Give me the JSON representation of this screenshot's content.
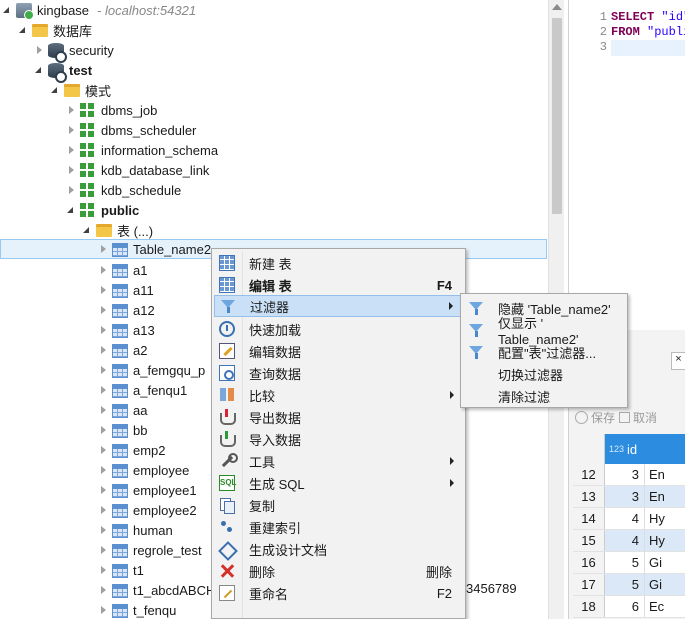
{
  "tree": {
    "connection": {
      "name": "kingbase",
      "host": "- localhost:54321"
    },
    "databases_folder": "数据库",
    "db_security": "security",
    "db_test": "test",
    "schemas_folder": "模式",
    "schemas": [
      "dbms_job",
      "dbms_scheduler",
      "information_schema",
      "kdb_database_link",
      "kdb_schedule",
      "public"
    ],
    "tables_folder": "表 (...)",
    "tables": [
      "Table_name2",
      "a1",
      "a11",
      "a12",
      "a13",
      "a2",
      "a_femgqu_p",
      "a_fenqu1",
      "aa",
      "bb",
      "emp2",
      "employee",
      "employee1",
      "employee2",
      "human",
      "regrole_test",
      "t1",
      "t1_abcdABCH",
      "t_fenqu"
    ],
    "overflow_text": "3456789"
  },
  "editor": {
    "line_numbers": [
      "1",
      "2",
      "3"
    ],
    "line1_kw": "SELECT",
    "line1_rest": " \"id\"",
    "line2_kw": "FROM",
    "line2_rest": " \"publi"
  },
  "results": {
    "close_label": "×",
    "save_label": "保存",
    "cancel_label": "取消",
    "id_type": "123",
    "id_header": "id",
    "rows": [
      {
        "n": "12",
        "id": "3",
        "txt": "En"
      },
      {
        "n": "13",
        "id": "3",
        "txt": "En"
      },
      {
        "n": "14",
        "id": "4",
        "txt": "Hy"
      },
      {
        "n": "15",
        "id": "4",
        "txt": "Hy"
      },
      {
        "n": "16",
        "id": "5",
        "txt": "Gi"
      },
      {
        "n": "17",
        "id": "5",
        "txt": "Gi"
      },
      {
        "n": "18",
        "id": "6",
        "txt": "Ec"
      }
    ]
  },
  "context_menu": {
    "items": [
      {
        "label": "新建 表",
        "key": "",
        "icon": "table-icon"
      },
      {
        "label": "编辑 表",
        "key": "F4",
        "icon": "table-icon"
      },
      {
        "label": "过滤器",
        "key": "",
        "icon": "funnel-icon"
      },
      {
        "label": "快速加载",
        "key": "",
        "icon": "clock-icon"
      },
      {
        "label": "编辑数据",
        "key": "",
        "icon": "edit-data-icon"
      },
      {
        "label": "查询数据",
        "key": "",
        "icon": "query-icon"
      },
      {
        "label": "比较",
        "key": "",
        "icon": "compare-icon"
      },
      {
        "label": "导出数据",
        "key": "",
        "icon": "export-icon"
      },
      {
        "label": "导入数据",
        "key": "",
        "icon": "import-icon"
      },
      {
        "label": "工具",
        "key": "",
        "icon": "wrench-icon"
      },
      {
        "label": "生成 SQL",
        "key": "",
        "icon": "sql-icon"
      },
      {
        "label": "复制",
        "key": "",
        "icon": "copy-icon"
      },
      {
        "label": "重建索引",
        "key": "",
        "icon": "index-icon"
      },
      {
        "label": "生成设计文档",
        "key": "",
        "icon": "doc-icon"
      },
      {
        "label": "删除",
        "key": "删除",
        "icon": "delete-icon"
      },
      {
        "label": "重命名",
        "key": "F2",
        "icon": "rename-icon"
      }
    ],
    "sql_icon_text": "SQL"
  },
  "filter_submenu": {
    "items": [
      {
        "label": "隐藏 'Table_name2'"
      },
      {
        "label": "仅显示 ' Table_name2'"
      },
      {
        "label": "配置\"表\"过滤器..."
      },
      {
        "label": "切换过滤器"
      },
      {
        "label": "清除过滤"
      }
    ]
  }
}
